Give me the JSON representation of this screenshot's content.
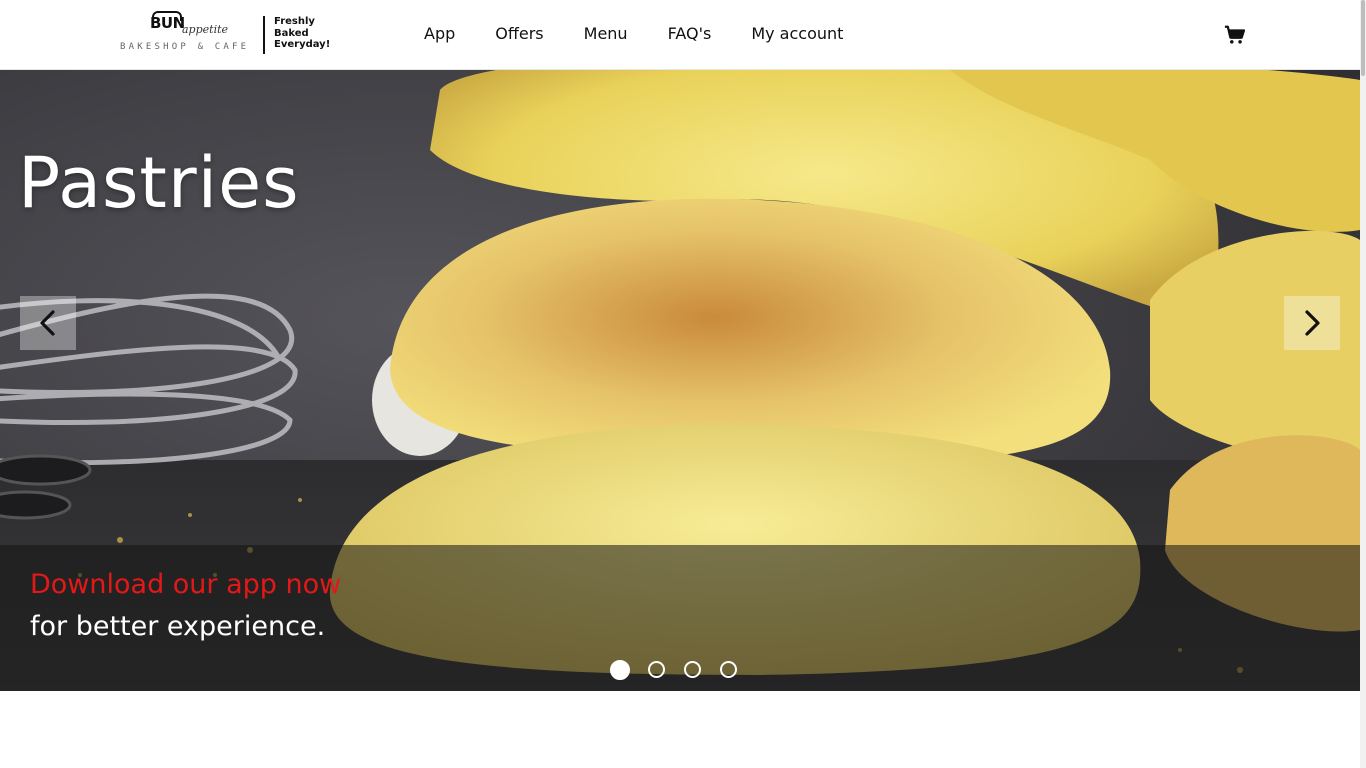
{
  "header": {
    "logo": {
      "brand": "BUN",
      "script": "appetite",
      "subtitle": "BAKESHOP & CAFE",
      "tagline": [
        "Freshly",
        "Baked",
        "Everyday!"
      ]
    },
    "nav": [
      {
        "label": "App"
      },
      {
        "label": "Offers"
      },
      {
        "label": "Menu"
      },
      {
        "label": "FAQ's"
      },
      {
        "label": "My account"
      }
    ],
    "cart_icon": "shopping-cart-icon"
  },
  "hero": {
    "title": "Pastries",
    "promo_line1": "Download our app now",
    "promo_line2": "for better experience.",
    "prev_icon": "chevron-left-icon",
    "next_icon": "chevron-right-icon",
    "slides_total": 4,
    "active_slide": 1
  },
  "colors": {
    "promo_accent": "#e31818",
    "overlay": "#141414",
    "text_on_dark": "#ffffff"
  }
}
